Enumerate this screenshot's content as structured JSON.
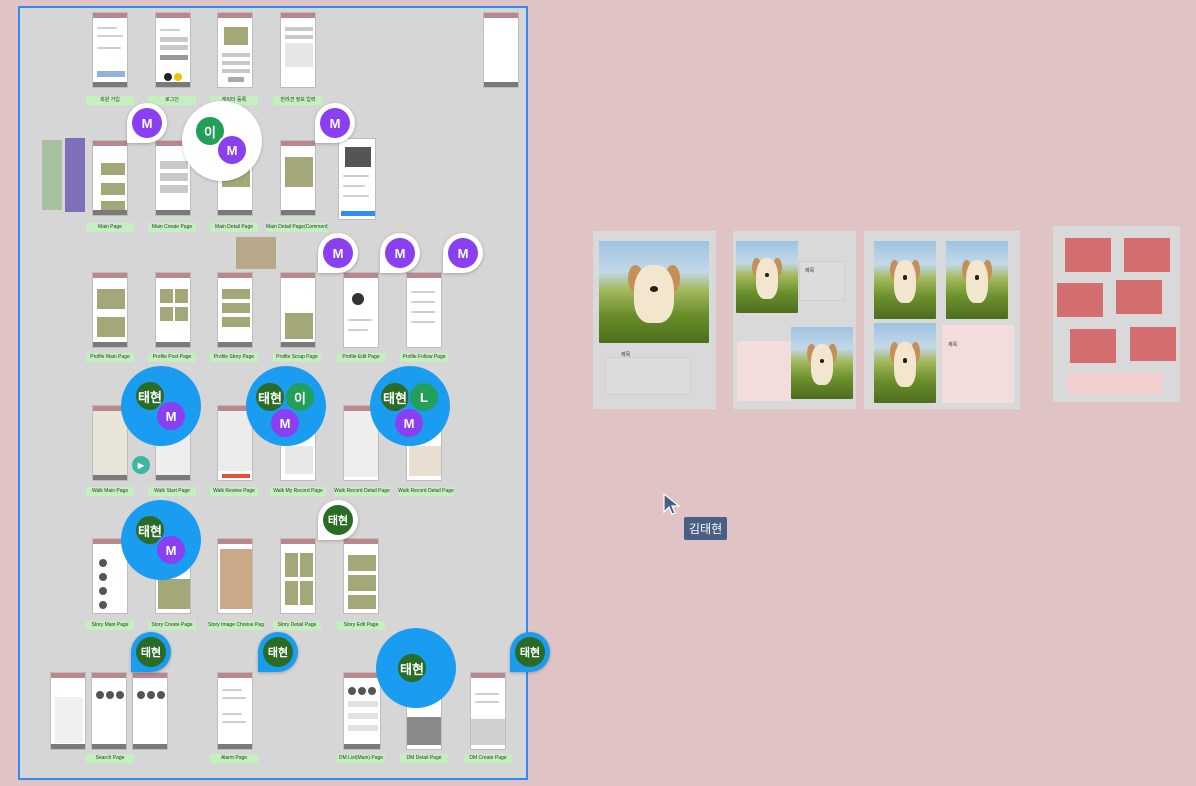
{
  "colors": {
    "canvas": "#e0c3c5",
    "selection": "#2f8cf0",
    "frame_label": "#c4f0bf",
    "avatar_m": "#8a3ff0",
    "avatar_taehyun": "#2a6b26",
    "avatar_lee": "#22a05a",
    "bubble_blue": "#1a9cf0",
    "cursor_tag": "#4a5f86"
  },
  "frames": {
    "row1": [
      "회원 가입",
      "로그인",
      "캐릭터 등록",
      "반려견 정보 입력"
    ],
    "row2": [
      "Main Page",
      "Main Create Page",
      "Main Detail Page",
      "Main Detail Page(Comment)"
    ],
    "row3": [
      "Profile Main Page",
      "Profile Post Page",
      "Profile Story Page",
      "Profile Scrap Page",
      "Profile Edit Page",
      "Profile Follow Page"
    ],
    "row4": [
      "Walk Main Page",
      "Walk Start Page",
      "Walk Review Page",
      "Walk My Record Page",
      "Walk Record Detail Page",
      "Walk Record Detail Page"
    ],
    "row5": [
      "Story Main Page",
      "Story Create Page",
      "Story Image Choose Page",
      "Story Detail Page",
      "Story Edit Page"
    ],
    "row6": [
      "Search Page",
      "Alarm Page",
      "DM List(Main) Page",
      "DM Detail Page",
      "DM Create Page"
    ]
  },
  "avatars": {
    "m": "M",
    "taehyun": "태현",
    "lee": "이",
    "l": "L"
  },
  "cursor": {
    "user_name": "김태현",
    "icon": "pointer-cursor-icon"
  },
  "boards": {
    "board1_caption": "제목",
    "board2_caption": "제목",
    "board3_caption": "제목"
  }
}
